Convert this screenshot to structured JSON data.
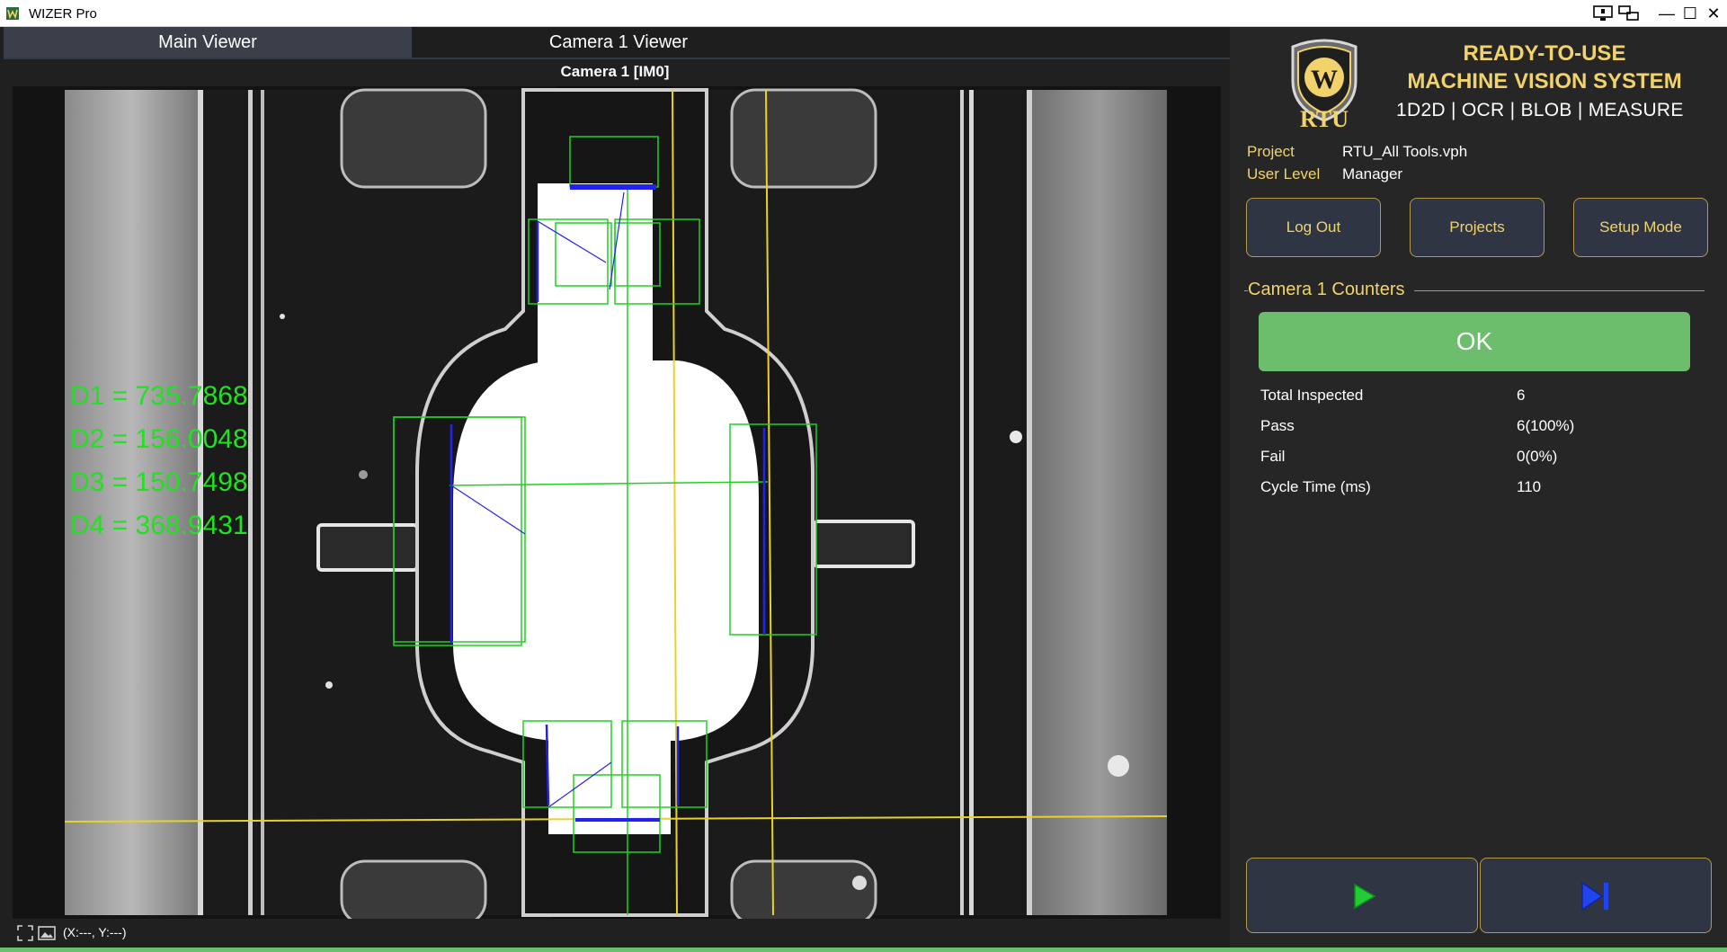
{
  "window": {
    "title": "WIZER Pro",
    "controls": [
      "_",
      "□",
      "✕"
    ]
  },
  "viewer": {
    "tabs": [
      {
        "label": "Main Viewer",
        "active": true
      },
      {
        "label": "Camera 1 Viewer",
        "active": false
      }
    ],
    "camera_label": "Camera 1  [IM0]",
    "measurements": [
      "D1 = 735.7868",
      "D2 = 156.0048",
      "D3 = 150.7498",
      "D4 = 368.9431"
    ],
    "coords": "(X:---, Y:---)"
  },
  "brand": {
    "logo_text": "RTU",
    "logo_letter": "W",
    "headline_1": "READY-TO-USE",
    "headline_2": "MACHINE VISION SYSTEM",
    "subline": "1D2D | OCR | BLOB | MEASURE"
  },
  "info": {
    "project_label": "Project",
    "project_value": "RTU_All Tools.vph",
    "user_label": "User Level",
    "user_value": "Manager"
  },
  "buttons": {
    "logout": "Log Out",
    "projects": "Projects",
    "setup": "Setup Mode"
  },
  "counters": {
    "title": "Camera 1 Counters",
    "status": "OK",
    "rows": [
      {
        "label": "Total Inspected",
        "value": "6"
      },
      {
        "label": "Pass",
        "value": "6(100%)"
      },
      {
        "label": "Fail",
        "value": "0(0%)"
      },
      {
        "label": "Cycle Time (ms)",
        "value": "110"
      }
    ]
  },
  "colors": {
    "accent_gold": "#f2d36b",
    "ok_green": "#6cbd6c",
    "overlay_green": "#22e022",
    "overlay_blue": "#2222ee",
    "overlay_yellow": "#e8d22a"
  }
}
